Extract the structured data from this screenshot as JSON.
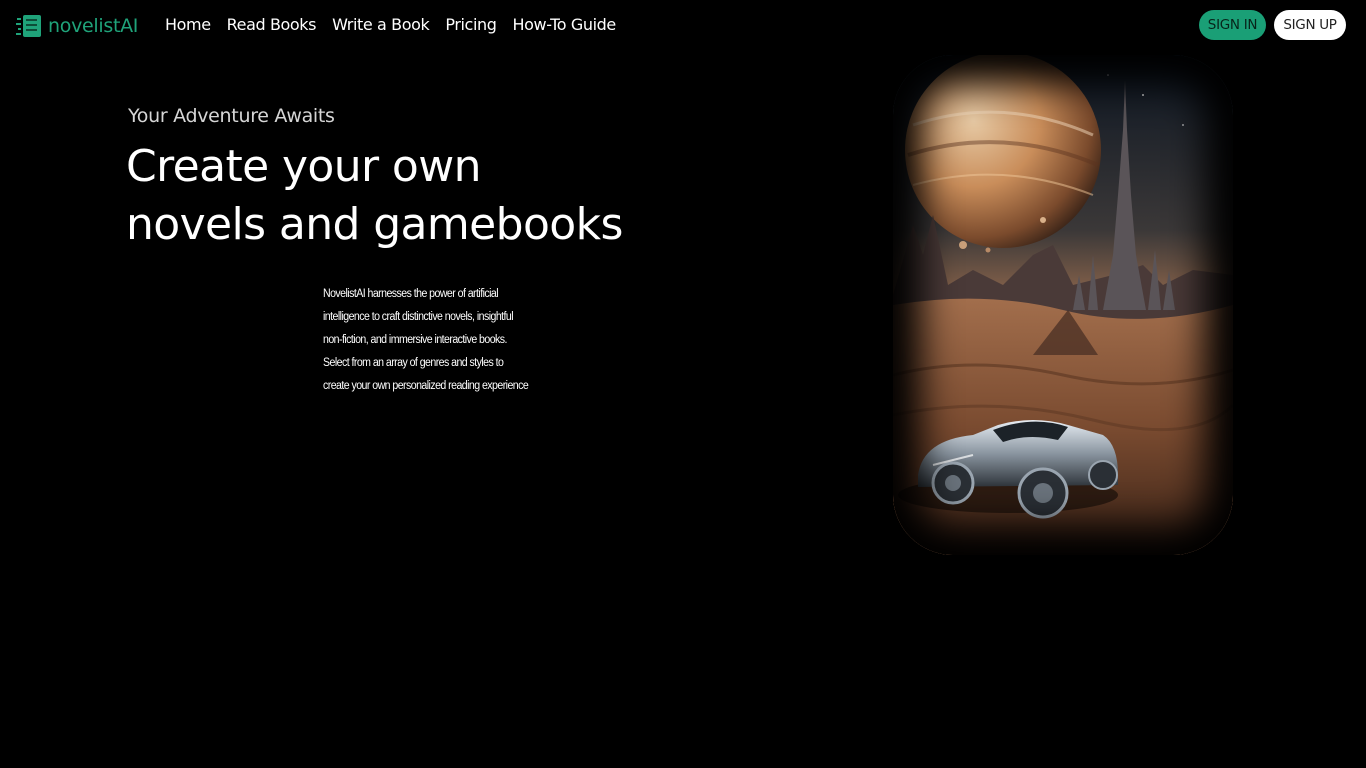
{
  "brand": {
    "name": "novelistAI",
    "logo_icon": "book-stack-icon",
    "accent_color": "#1fa37a"
  },
  "nav": {
    "links": [
      {
        "label": "Home"
      },
      {
        "label": "Read Books"
      },
      {
        "label": "Write a Book"
      },
      {
        "label": "Pricing"
      },
      {
        "label": "How-To Guide"
      }
    ],
    "signin_label": "SIGN IN",
    "signup_label": "SIGN UP"
  },
  "hero": {
    "eyebrow": "Your Adventure Awaits",
    "headline_line1": "Create your own",
    "headline_line2": "novels and gamebooks",
    "description": "NovelistAI harnesses the power of artificial intelligence to craft distinctive novels, insightful non-fiction, and immersive interactive books. Select from an array of genres and styles to create your own personalized reading experience"
  },
  "illustration": {
    "subject": "sci-fi desert landscape with ringed planet, spire city and futuristic car"
  }
}
